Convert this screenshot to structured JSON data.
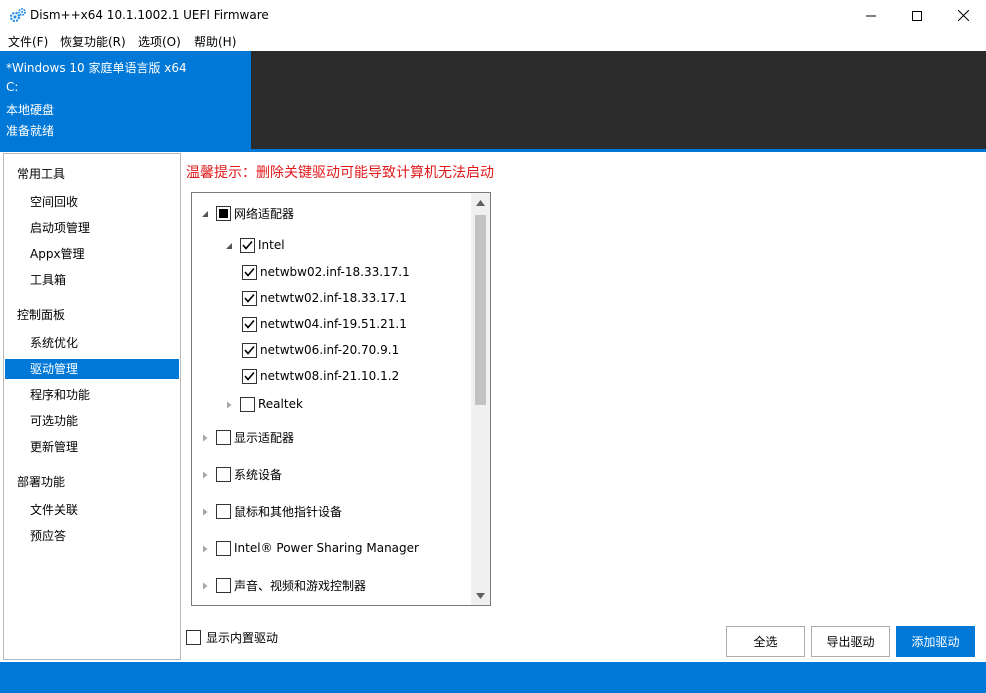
{
  "window": {
    "title": "Dism++x64 10.1.1002.1 UEFI Firmware",
    "app_icon": "gears-icon",
    "controls": [
      "minimize-icon",
      "maximize-icon",
      "close-icon"
    ]
  },
  "menu": [
    "文件(F)",
    "恢复功能(R)",
    "选项(O)",
    "帮助(H)"
  ],
  "image_info": {
    "edition": "*Windows 10 家庭单语言版 x64",
    "drive": "C:",
    "disk": "本地硬盘",
    "status": "准备就绪"
  },
  "sidebar": {
    "groups": [
      {
        "label": "常用工具",
        "items": [
          "空间回收",
          "启动项管理",
          "Appx管理",
          "工具箱"
        ]
      },
      {
        "label": "控制面板",
        "items": [
          "系统优化",
          "驱动管理",
          "程序和功能",
          "可选功能",
          "更新管理"
        ]
      },
      {
        "label": "部署功能",
        "items": [
          "文件关联",
          "预应答"
        ]
      }
    ],
    "active_item": "驱动管理"
  },
  "warning": "温馨提示：删除关键驱动可能导致计算机无法启动",
  "tree": [
    {
      "label": "网络适配器",
      "state": "partial",
      "expanded": true,
      "level": 0
    },
    {
      "label": "Intel",
      "state": "checked",
      "expanded": true,
      "level": 1
    },
    {
      "label": "netwbw02.inf-18.33.17.1",
      "state": "checked",
      "level": 2
    },
    {
      "label": "netwtw02.inf-18.33.17.1",
      "state": "checked",
      "level": 2
    },
    {
      "label": "netwtw04.inf-19.51.21.1",
      "state": "checked",
      "level": 2
    },
    {
      "label": "netwtw06.inf-20.70.9.1",
      "state": "checked",
      "level": 2
    },
    {
      "label": "netwtw08.inf-21.10.1.2",
      "state": "checked",
      "level": 2
    },
    {
      "label": "Realtek",
      "state": "unchecked",
      "expanded": false,
      "level": 1
    },
    {
      "label": "显示适配器",
      "state": "unchecked",
      "expanded": false,
      "level": 0
    },
    {
      "label": "系统设备",
      "state": "unchecked",
      "expanded": false,
      "level": 0
    },
    {
      "label": "鼠标和其他指针设备",
      "state": "unchecked",
      "expanded": false,
      "level": 0
    },
    {
      "label": "Intel® Power Sharing Manager",
      "state": "unchecked",
      "expanded": false,
      "level": 0
    },
    {
      "label": "声音、视频和游戏控制器",
      "state": "unchecked",
      "expanded": false,
      "level": 0
    }
  ],
  "show_builtin": {
    "label": "显示内置驱动",
    "checked": false
  },
  "buttons": {
    "select_all": "全选",
    "export": "导出驱动",
    "add": "添加驱动"
  },
  "colors": {
    "accent": "#0078d7",
    "warning": "#e0191b",
    "dark_panel": "#2b2b2b"
  }
}
